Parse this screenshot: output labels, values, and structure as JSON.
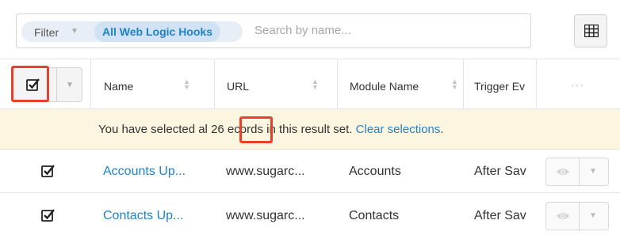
{
  "filter": {
    "label": "Filter",
    "chip": "All Web Logic Hooks",
    "search_placeholder": "Search by name..."
  },
  "header": {
    "columns": [
      "Name",
      "URL",
      "Module Name",
      "Trigger Ev"
    ],
    "more": "···"
  },
  "alert": {
    "prefix": "You have selected al",
    "count": "26",
    "suffix": "ecords in this result set.",
    "link": "Clear selections",
    "period": "."
  },
  "rows": [
    {
      "name": "Accounts Up...",
      "url": "www.sugarc...",
      "module": "Accounts",
      "trigger": "After Sav",
      "checked": true
    },
    {
      "name": "Contacts Up...",
      "url": "www.sugarc...",
      "module": "Contacts",
      "trigger": "After Sav",
      "checked": true
    }
  ],
  "colors": {
    "link": "#1f82c9",
    "highlight_red": "#e8402a",
    "alert_bg": "#fcf6e0",
    "chip_bg": "#d0e2f3"
  },
  "icons": {
    "grid_toggle": "grid-icon",
    "preview": "eye-icon",
    "checkbox": "checkbox-checked-icon"
  }
}
